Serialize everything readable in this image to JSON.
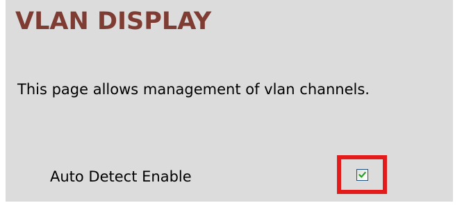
{
  "page": {
    "title": "VLAN DISPLAY",
    "description": "This page allows management of vlan channels."
  },
  "auto_detect": {
    "label": "Auto Detect Enable",
    "checked": true,
    "checkbox_icon": "checkmark-icon"
  },
  "colors": {
    "panel_background": "#dcdcdc",
    "title": "#7f3c33",
    "highlight_border": "#e31b1b",
    "checkmark": "#21a121"
  }
}
